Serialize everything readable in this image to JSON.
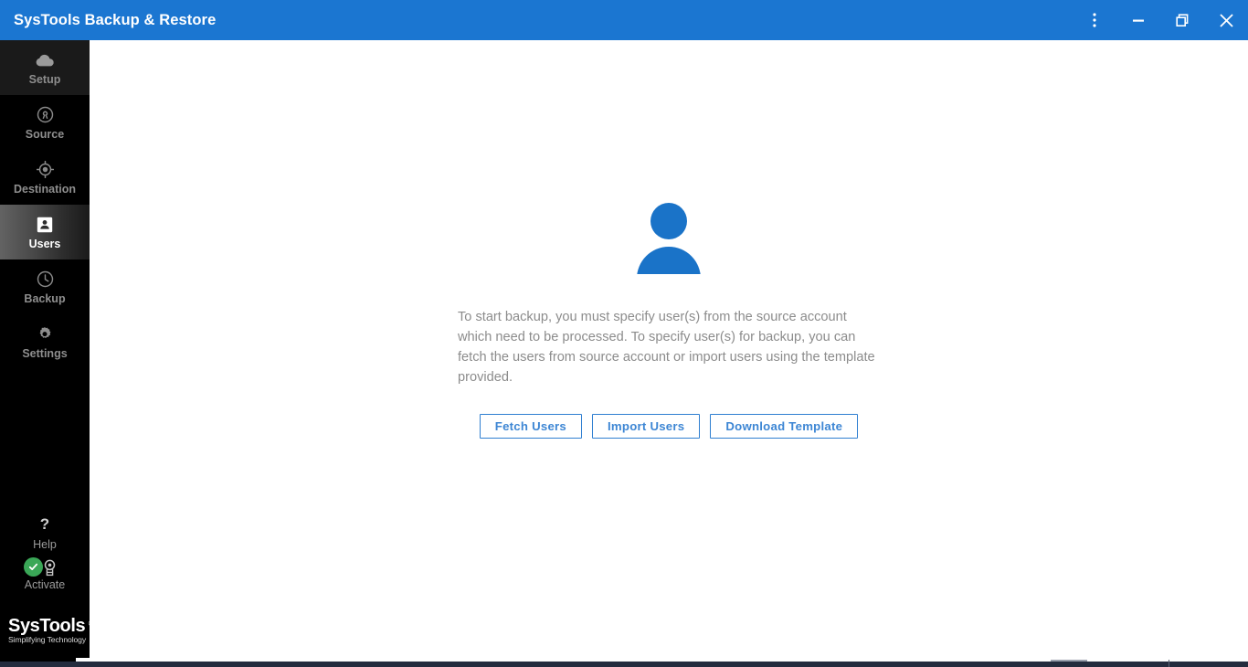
{
  "window": {
    "title": "SysTools Backup & Restore",
    "accent_color": "#1b76d1",
    "controls": [
      {
        "name": "more-options",
        "label": "More options",
        "icon": "kebab-menu-icon"
      },
      {
        "name": "minimize",
        "label": "Minimize",
        "icon": "minimize-icon"
      },
      {
        "name": "restore",
        "label": "Restore",
        "icon": "restore-icon"
      },
      {
        "name": "close",
        "label": "Close",
        "icon": "close-icon"
      }
    ]
  },
  "sidebar": {
    "background": "#000000",
    "active_item": "Users",
    "items": [
      {
        "label": "Setup",
        "icon": "cloud-icon",
        "active": false
      },
      {
        "label": "Source",
        "icon": "source-icon",
        "active": false
      },
      {
        "label": "Destination",
        "icon": "target-icon",
        "active": false
      },
      {
        "label": "Users",
        "icon": "user-card-icon",
        "active": true
      },
      {
        "label": "Backup",
        "icon": "clock-icon",
        "active": false
      },
      {
        "label": "Settings",
        "icon": "gear-icon",
        "active": false
      }
    ],
    "utilities": [
      {
        "label": "Help",
        "icon": "question-mark-icon"
      },
      {
        "label": "Activate",
        "icon": "award-icon",
        "badge": "check-badge",
        "badge_color": "#3aa757"
      }
    ],
    "logo": {
      "name": "SysTools",
      "registered_mark": "®",
      "tagline": "Simplifying Technology"
    }
  },
  "main": {
    "empty_state": {
      "icon": "user-avatar-icon",
      "icon_color": "#1a73c8",
      "description": "To start backup, you must specify user(s) from the source account which need to be processed. To specify user(s) for backup, you can fetch the users from source account or import users using the template provided.",
      "buttons": [
        {
          "label": "Fetch Users"
        },
        {
          "label": "Import Users"
        },
        {
          "label": "Download Template"
        }
      ]
    }
  }
}
